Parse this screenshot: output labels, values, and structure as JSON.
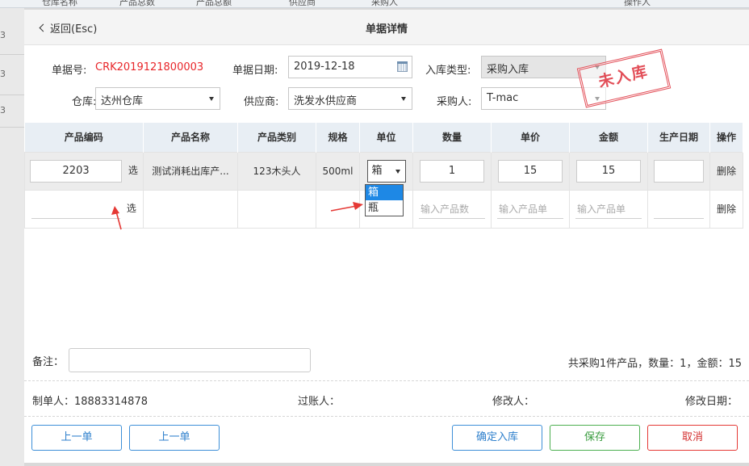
{
  "background": {
    "header_cols": [
      "仓库名称",
      "产品总数",
      "产品总额",
      "供应商",
      "采购人",
      "操作人"
    ],
    "left_row_marks": [
      "3",
      "3",
      "3"
    ]
  },
  "dialog": {
    "back_label": "返回(Esc)",
    "title": "单据详情",
    "form": {
      "doc_no_label": "单据号:",
      "doc_no": "CRK2019121800003",
      "date_label": "单据日期:",
      "date": "2019-12-18",
      "type_label": "入库类型:",
      "type": "采购入库",
      "warehouse_label": "仓库:",
      "warehouse": "达州仓库",
      "supplier_label": "供应商:",
      "supplier": "洗发水供应商",
      "buyer_label": "采购人:",
      "buyer": "T-mac"
    },
    "stamp": "未入库",
    "table": {
      "headers": [
        "产品编码",
        "产品名称",
        "产品类别",
        "规格",
        "单位",
        "数量",
        "单价",
        "金额",
        "生产日期",
        "操作"
      ],
      "rows": [
        {
          "code": "2203",
          "pick": "选",
          "name": "测试消耗出库产...",
          "category": "123木头人",
          "spec": "500ml",
          "unit": "箱",
          "qty": "1",
          "price": "15",
          "amount": "15",
          "date": "",
          "op": "删除"
        },
        {
          "code": "",
          "pick": "选",
          "name": "",
          "category": "",
          "spec": "",
          "unit": "",
          "qty_placeholder": "输入产品数",
          "price_placeholder": "输入产品单",
          "amount_placeholder": "输入产品单",
          "date": "",
          "op": "删除"
        }
      ],
      "unit_options": [
        "箱",
        "瓶"
      ],
      "unit_selected": "箱"
    },
    "remark_label": "备注：",
    "summary": "共采购1件产品，数量：1，金额：15",
    "maker": "制单人：18883314878",
    "poster": "过账人：",
    "modifier": "修改人：",
    "modify_date": "修改日期：",
    "buttons": {
      "prev1": "上一单",
      "prev2": "上一单",
      "confirm": "确定入库",
      "save": "保存",
      "cancel": "取消"
    }
  },
  "colors": {
    "accent_blue": "#2d7fcc",
    "doc_no_red": "#e8262a",
    "stamp_red": "#e0404a",
    "save_green": "#3a9c3f",
    "cancel_red": "#d32f2f",
    "dropdown_selected": "#1e88e5",
    "annotation_arrow": "#e53935"
  }
}
